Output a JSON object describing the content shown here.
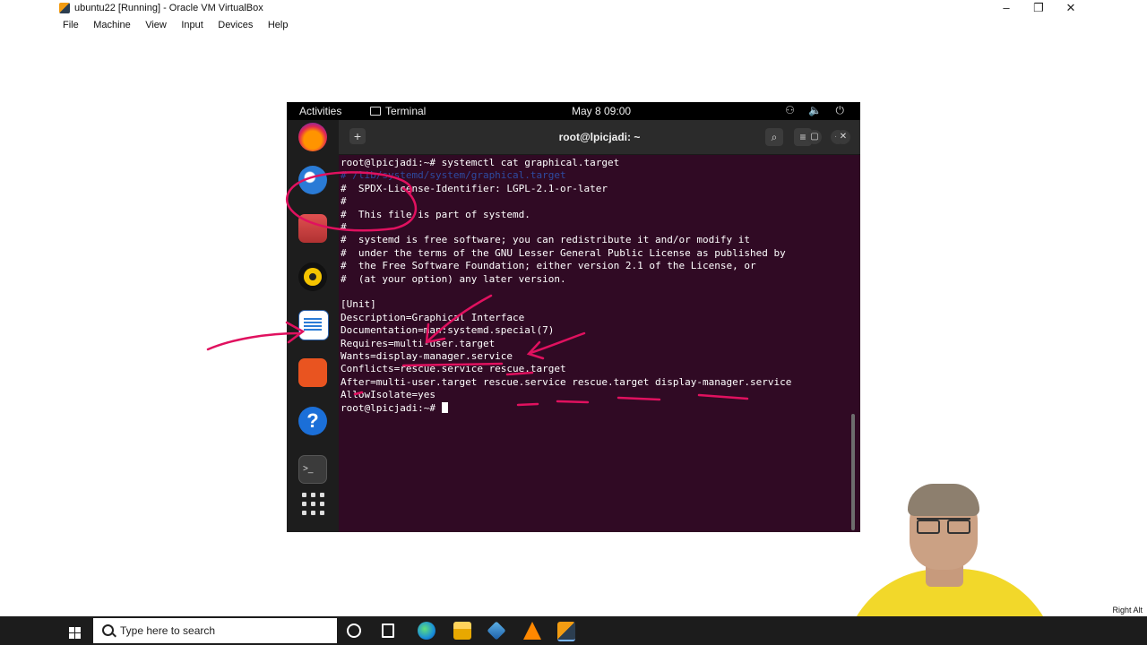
{
  "host": {
    "title": "ubuntu22 [Running] - Oracle VM VirtualBox",
    "menu": [
      "File",
      "Machine",
      "View",
      "Input",
      "Devices",
      "Help"
    ],
    "minimize": "–",
    "restore": "❐",
    "close": "✕"
  },
  "vm_topbar": {
    "activities": "Activities",
    "app": "Terminal",
    "clock": "May 8  09:00",
    "tray": "⚇ 🔈 ⏻"
  },
  "terminal": {
    "title": "root@lpicjadi: ~",
    "new_tab": "+",
    "search": "⌕",
    "menu": "≡",
    "minimize": "–",
    "maximize": "▢",
    "close": "✕",
    "lines": [
      "root@lpicjadi:~# systemctl cat graphical.target",
      "# /lib/systemd/system/graphical.target",
      "#  SPDX-License-Identifier: LGPL-2.1-or-later",
      "#",
      "#  This file is part of systemd.",
      "#",
      "#  systemd is free software; you can redistribute it and/or modify it",
      "#  under the terms of the GNU Lesser General Public License as published by",
      "#  the Free Software Foundation; either version 2.1 of the License, or",
      "#  (at your option) any later version.",
      "",
      "[Unit]",
      "Description=Graphical Interface",
      "Documentation=man:systemd.special(7)",
      "Requires=multi-user.target",
      "Wants=display-manager.service",
      "Conflicts=rescue.service rescue.target",
      "After=multi-user.target rescue.service rescue.target display-manager.service",
      "AllowIsolate=yes",
      "root@lpicjadi:~# "
    ]
  },
  "taskbar": {
    "search_placeholder": "Type here to search",
    "tray_text": "Right Alt"
  },
  "colors": {
    "terminal_bg": "#300a24",
    "annotation_ink": "#e0115f"
  }
}
